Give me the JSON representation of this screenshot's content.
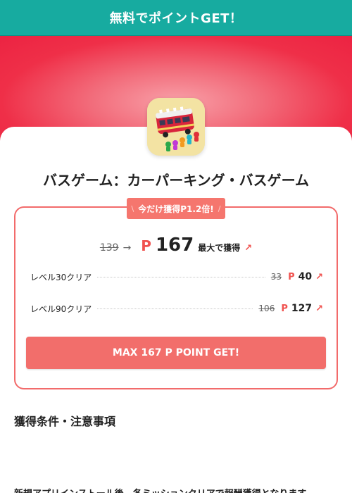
{
  "header": {
    "title": "無料でポイントGET！"
  },
  "app": {
    "icon_name": "bus-game-app-icon",
    "title": "バスゲーム：カーパーキング・バスゲーム"
  },
  "offer": {
    "ribbon_left": "\\",
    "ribbon_text": "今だけ獲得P1.2倍!",
    "ribbon_right": "/",
    "old_points": "139",
    "arrow": "→",
    "point_mark": "P",
    "points": "167",
    "max_label": "最大で獲得",
    "up_icon": "↗",
    "levels": [
      {
        "label": "レベル30クリア",
        "old": "33",
        "p": "P",
        "value": "40",
        "icon": "↗"
      },
      {
        "label": "レベル90クリア",
        "old": "106",
        "p": "P",
        "value": "127",
        "icon": "↗"
      }
    ],
    "cta_label": "MAX 167 P POINT GET!"
  },
  "conditions": {
    "heading": "獲得条件・注意事項",
    "note": "新規アプリインストール後、各ミッションクリアで報酬獲得となります。"
  },
  "colors": {
    "header_bg": "#17aba0",
    "hero_red": "#ec2342",
    "accent": "#f26e6b",
    "point_red": "#f0524f"
  }
}
